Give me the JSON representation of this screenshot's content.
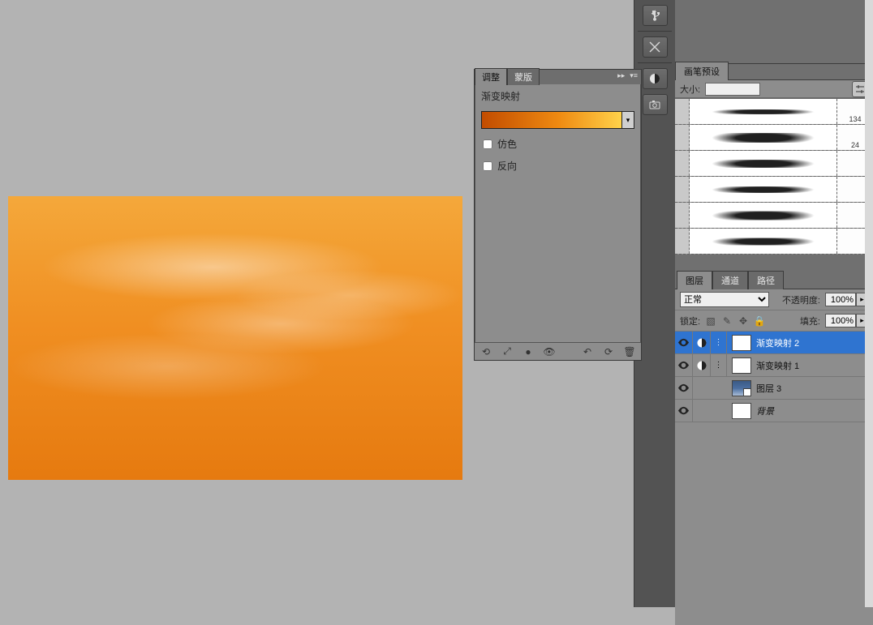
{
  "side_strip": {
    "icons": [
      "usb",
      "tools",
      "circle",
      "camera"
    ]
  },
  "brush_panel": {
    "tab": "画笔预设",
    "size_label": "大小:",
    "rows": [
      {
        "num": "",
        "mini": "134"
      },
      {
        "num": "",
        "mini": "24"
      },
      {
        "num": "",
        "mini": ""
      },
      {
        "num": "",
        "mini": ""
      },
      {
        "num": "",
        "mini": ""
      },
      {
        "num": "",
        "mini": ""
      }
    ]
  },
  "layers_panel": {
    "tabs": {
      "layers": "图层",
      "channels": "通道",
      "paths": "路径"
    },
    "blend_mode": "正常",
    "opacity_label": "不透明度:",
    "opacity_value": "100%",
    "lock_label": "锁定:",
    "fill_label": "填充:",
    "fill_value": "100%",
    "layers": [
      {
        "name": "渐变映射 2",
        "type": "gradient-map",
        "selected": true
      },
      {
        "name": "渐变映射 1",
        "type": "gradient-map",
        "selected": false
      },
      {
        "name": "图层 3",
        "type": "smart-img",
        "selected": false
      },
      {
        "name": "背景",
        "type": "background",
        "selected": false
      }
    ]
  },
  "adjust_panel": {
    "tabs": {
      "active": "调整",
      "other": "蒙版"
    },
    "title": "渐变映射",
    "dither_label": "仿色",
    "reverse_label": "反向",
    "footer_icons": [
      "back",
      "fit",
      "view",
      "target",
      "refresh",
      "reset",
      "trash"
    ]
  },
  "chart_data": null
}
